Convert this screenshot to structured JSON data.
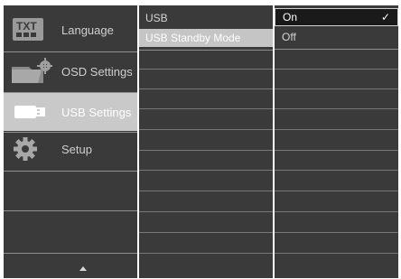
{
  "menu": {
    "items": [
      {
        "label": "Language",
        "icon": "txt-icon",
        "selected": false
      },
      {
        "label": "OSD Settings",
        "icon": "osd-settings-icon",
        "selected": false
      },
      {
        "label": "USB Settings",
        "icon": "usb-icon",
        "selected": true
      },
      {
        "label": "Setup",
        "icon": "gear-icon",
        "selected": false
      }
    ],
    "txt_icon_text": "TXT"
  },
  "submenu": {
    "items": [
      {
        "label": "USB",
        "selected": false
      },
      {
        "label": "USB Standby Mode",
        "selected": true
      }
    ]
  },
  "options": {
    "items": [
      {
        "label": "On",
        "selected": true,
        "checked": true
      },
      {
        "label": "Off",
        "selected": false,
        "checked": false
      }
    ],
    "check_glyph": "✓"
  },
  "colors": {
    "panel": "#3a3a3a",
    "highlight": "#c9c9c9",
    "selected_option": "#1a1a1a"
  }
}
